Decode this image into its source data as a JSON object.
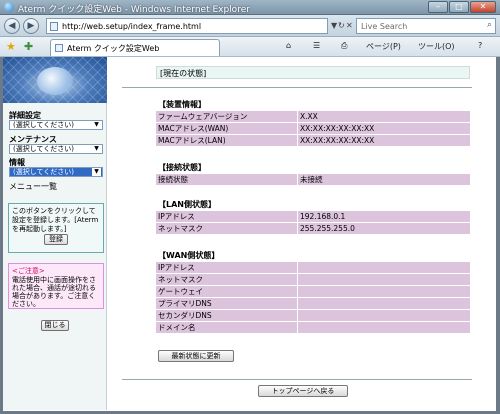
{
  "window": {
    "title": "Aterm クイック設定Web - Windows Internet Explorer",
    "minimize": "–",
    "maximize": "□",
    "close": "✕"
  },
  "address": {
    "back": "◀",
    "forward": "▶",
    "url": "http://web.setup/index_frame.html",
    "go": "▼",
    "refresh": "↻",
    "stop": "✕",
    "search_placeholder": "Live Search",
    "search_icon": "search-icon"
  },
  "toolbar": {
    "tab_label": "Aterm クイック設定Web",
    "home": "⌂",
    "feeds": "☰",
    "print": "⎙",
    "page": "ページ(P)",
    "tools": "ツール(O)",
    "help": "?"
  },
  "sidebar": {
    "advanced_label": "詳細設定",
    "advanced_value": "(選択してください)",
    "maintenance_label": "メンテナンス",
    "maintenance_value": "(選択してください)",
    "info_label": "情報",
    "info_value": "(選択してください)",
    "menu_list": "メニュー一覧",
    "register_text": "このボタンをクリックして設定を登録します。[Atermを再起動します。]",
    "register_button": "登録",
    "caution_title": "<ご注意>",
    "caution_text": "電話使用中に画面操作をされた場合、通話が途切れる場合があります。ご注意ください。",
    "close_button": "閉じる"
  },
  "main": {
    "page_title": "[現在の状態]",
    "device_section": "【装置情報】",
    "device_rows": [
      {
        "k": "ファームウェアバージョン",
        "v": "X.XX"
      },
      {
        "k": "MACアドレス(WAN)",
        "v": "XX:XX:XX:XX:XX:XX"
      },
      {
        "k": "MACアドレス(LAN)",
        "v": "XX:XX:XX:XX:XX:XX"
      }
    ],
    "connection_section": "【接続状態】",
    "connection_rows": [
      {
        "k": "接続状態",
        "v": "未接続"
      }
    ],
    "lan_section": "【LAN側状態】",
    "lan_rows": [
      {
        "k": "IPアドレス",
        "v": "192.168.0.1"
      },
      {
        "k": "ネットマスク",
        "v": "255.255.255.0"
      }
    ],
    "wan_section": "【WAN側状態】",
    "wan_rows": [
      {
        "k": "IPアドレス",
        "v": ""
      },
      {
        "k": "ネットマスク",
        "v": ""
      },
      {
        "k": "ゲートウェイ",
        "v": ""
      },
      {
        "k": "プライマリDNS",
        "v": ""
      },
      {
        "k": "セカンダリDNS",
        "v": ""
      },
      {
        "k": "ドメイン名",
        "v": ""
      }
    ],
    "refresh_button": "最新状態に更新",
    "back_top_button": "トップページへ戻る"
  },
  "colors": {
    "row_bg": "#dcc4dc",
    "title_bar_bg": "#eaf6f4",
    "caution_bg": "#fde8fa",
    "sidebar_bg": "#f0f6f6"
  }
}
